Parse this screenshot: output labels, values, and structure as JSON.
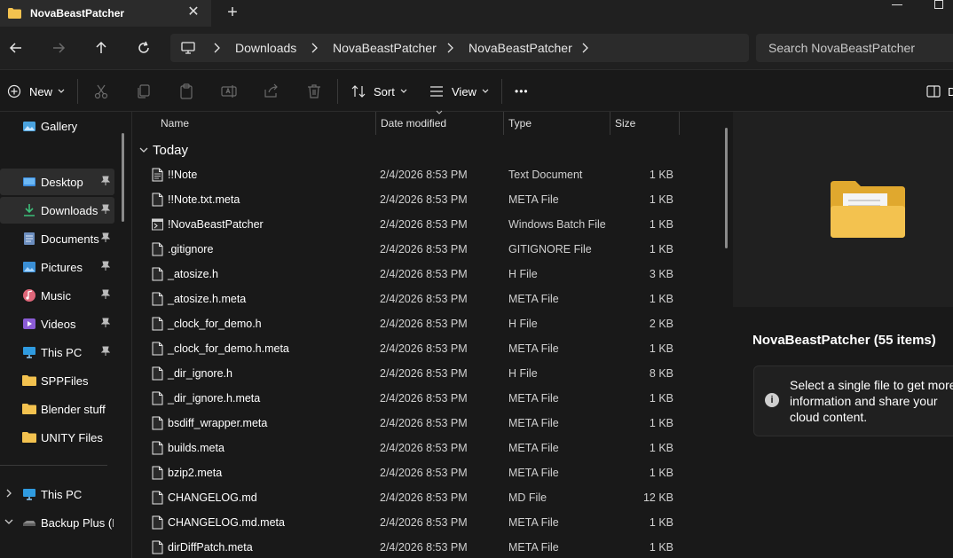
{
  "window": {
    "tab_title": "NovaBeastPatcher",
    "tab_close": "✕",
    "new_tab": "+"
  },
  "address": {
    "crumbs": [
      "Downloads",
      "NovaBeastPatcher",
      "NovaBeastPatcher"
    ],
    "search_placeholder": "Search NovaBeastPatcher"
  },
  "commands": {
    "new_label": "New",
    "sort_label": "Sort",
    "view_label": "View",
    "more_label": "•••",
    "details_label": "D"
  },
  "sidebar": {
    "items": [
      {
        "label": "Gallery",
        "icon": "gallery-icon",
        "pinned": false
      },
      {
        "label": "Desktop",
        "icon": "desktop-icon",
        "pinned": true
      },
      {
        "label": "Downloads",
        "icon": "downloads-icon",
        "pinned": true
      },
      {
        "label": "Documents",
        "icon": "documents-icon",
        "pinned": true
      },
      {
        "label": "Pictures",
        "icon": "pictures-icon",
        "pinned": true
      },
      {
        "label": "Music",
        "icon": "music-icon",
        "pinned": true
      },
      {
        "label": "Videos",
        "icon": "videos-icon",
        "pinned": true
      },
      {
        "label": "This PC",
        "icon": "this-pc-icon",
        "pinned": true
      },
      {
        "label": "SPPFiles",
        "icon": "folder-icon",
        "pinned": false
      },
      {
        "label": "Blender stuff",
        "icon": "folder-icon",
        "pinned": false
      },
      {
        "label": "UNITY Files",
        "icon": "folder-icon",
        "pinned": false
      },
      {
        "label": "This PC",
        "icon": "this-pc-icon",
        "pinned": false
      },
      {
        "label": "Backup Plus (D:)",
        "icon": "drive-icon",
        "pinned": false
      }
    ],
    "status": "55 items"
  },
  "columns": {
    "name": "Name",
    "date": "Date modified",
    "type": "Type",
    "size": "Size"
  },
  "group": {
    "label": "Today"
  },
  "files": [
    {
      "name": "!!Note",
      "date": "2/4/2026 8:53 PM",
      "type": "Text Document",
      "size": "1 KB",
      "icon": "text-file-icon"
    },
    {
      "name": "!!Note.txt.meta",
      "date": "2/4/2026 8:53 PM",
      "type": "META File",
      "size": "1 KB",
      "icon": "file-icon"
    },
    {
      "name": "!NovaBeastPatcher",
      "date": "2/4/2026 8:53 PM",
      "type": "Windows Batch File",
      "size": "1 KB",
      "icon": "batch-file-icon"
    },
    {
      "name": ".gitignore",
      "date": "2/4/2026 8:53 PM",
      "type": "GITIGNORE File",
      "size": "1 KB",
      "icon": "file-icon"
    },
    {
      "name": "_atosize.h",
      "date": "2/4/2026 8:53 PM",
      "type": "H File",
      "size": "3 KB",
      "icon": "file-icon"
    },
    {
      "name": "_atosize.h.meta",
      "date": "2/4/2026 8:53 PM",
      "type": "META File",
      "size": "1 KB",
      "icon": "file-icon"
    },
    {
      "name": "_clock_for_demo.h",
      "date": "2/4/2026 8:53 PM",
      "type": "H File",
      "size": "2 KB",
      "icon": "file-icon"
    },
    {
      "name": "_clock_for_demo.h.meta",
      "date": "2/4/2026 8:53 PM",
      "type": "META File",
      "size": "1 KB",
      "icon": "file-icon"
    },
    {
      "name": "_dir_ignore.h",
      "date": "2/4/2026 8:53 PM",
      "type": "H File",
      "size": "8 KB",
      "icon": "file-icon"
    },
    {
      "name": "_dir_ignore.h.meta",
      "date": "2/4/2026 8:53 PM",
      "type": "META File",
      "size": "1 KB",
      "icon": "file-icon"
    },
    {
      "name": "bsdiff_wrapper.meta",
      "date": "2/4/2026 8:53 PM",
      "type": "META File",
      "size": "1 KB",
      "icon": "file-icon"
    },
    {
      "name": "builds.meta",
      "date": "2/4/2026 8:53 PM",
      "type": "META File",
      "size": "1 KB",
      "icon": "file-icon"
    },
    {
      "name": "bzip2.meta",
      "date": "2/4/2026 8:53 PM",
      "type": "META File",
      "size": "1 KB",
      "icon": "file-icon"
    },
    {
      "name": "CHANGELOG.md",
      "date": "2/4/2026 8:53 PM",
      "type": "MD File",
      "size": "12 KB",
      "icon": "file-icon"
    },
    {
      "name": "CHANGELOG.md.meta",
      "date": "2/4/2026 8:53 PM",
      "type": "META File",
      "size": "1 KB",
      "icon": "file-icon"
    },
    {
      "name": "dirDiffPatch.meta",
      "date": "2/4/2026 8:53 PM",
      "type": "META File",
      "size": "1 KB",
      "icon": "file-icon"
    }
  ],
  "details": {
    "title": "NovaBeastPatcher (55 items)",
    "info_icon": "i",
    "info_text": "Select a single file to get more information and share your cloud content."
  },
  "colors": {
    "accent": "#4cc2ff",
    "folder": "#f3c24f",
    "folder_dark": "#e0a82e"
  }
}
